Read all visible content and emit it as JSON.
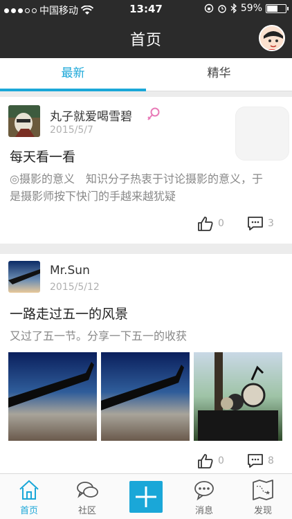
{
  "status": {
    "carrier": "中国移动",
    "time": "13:47",
    "battery": "59%",
    "battery_level": 0.59
  },
  "nav": {
    "title": "首页"
  },
  "tabs": [
    {
      "label": "最新",
      "active": true
    },
    {
      "label": "精华",
      "active": false
    }
  ],
  "posts": [
    {
      "author": "丸子就爱喝雪碧",
      "gender_icon": "female-icon",
      "date": "2015/5/7",
      "title": "每天看一看",
      "body": "◎摄影的意义　知识分子热衷于讨论摄影的意义，于是摄影师按下快门的手越来越犹疑",
      "likes": "0",
      "comments": "3"
    },
    {
      "author": "Mr.Sun",
      "date": "2015/5/12",
      "title": "一路走过五一的风景",
      "body": "又过了五一节。分享一下五一的收获",
      "likes": "0",
      "comments": "8"
    }
  ],
  "tabbar": [
    {
      "label": "首页",
      "icon": "home-icon",
      "active": true
    },
    {
      "label": "社区",
      "icon": "chat-bubbles-icon",
      "active": false
    },
    {
      "label": "",
      "icon": "plus-icon",
      "active": false
    },
    {
      "label": "消息",
      "icon": "message-icon",
      "active": false
    },
    {
      "label": "发现",
      "icon": "map-icon",
      "active": false
    }
  ],
  "colors": {
    "accent": "#1aa7d8",
    "bar": "#2b2b2b"
  }
}
